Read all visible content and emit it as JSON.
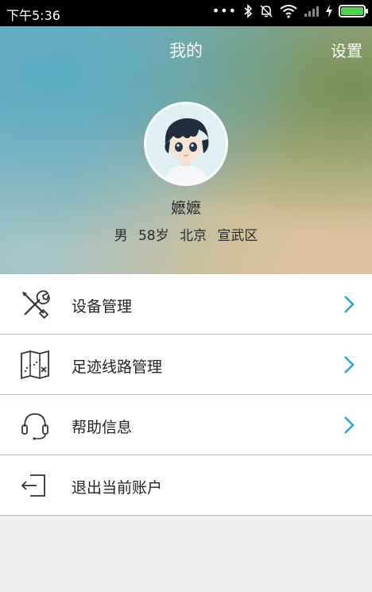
{
  "status_bar": {
    "time": "下午5:36",
    "icons": [
      "more-dots-icon",
      "bluetooth-icon",
      "mute-bell-icon",
      "wifi-icon",
      "signal-icon",
      "charging-icon",
      "battery-icon"
    ],
    "battery_color": "#4bd34b"
  },
  "header": {
    "title": "我的",
    "settings_label": "设置"
  },
  "profile": {
    "name": "嬷嬷",
    "gender": "男",
    "age": "58岁",
    "city": "北京",
    "district": "宣武区"
  },
  "menu": {
    "items": [
      {
        "label": "设备管理",
        "icon": "tools-icon"
      },
      {
        "label": "足迹线路管理",
        "icon": "map-icon"
      },
      {
        "label": "帮助信息",
        "icon": "headset-icon"
      },
      {
        "label": "退出当前账户",
        "icon": "logout-icon"
      }
    ],
    "arrow_color": "#29a8d6"
  }
}
